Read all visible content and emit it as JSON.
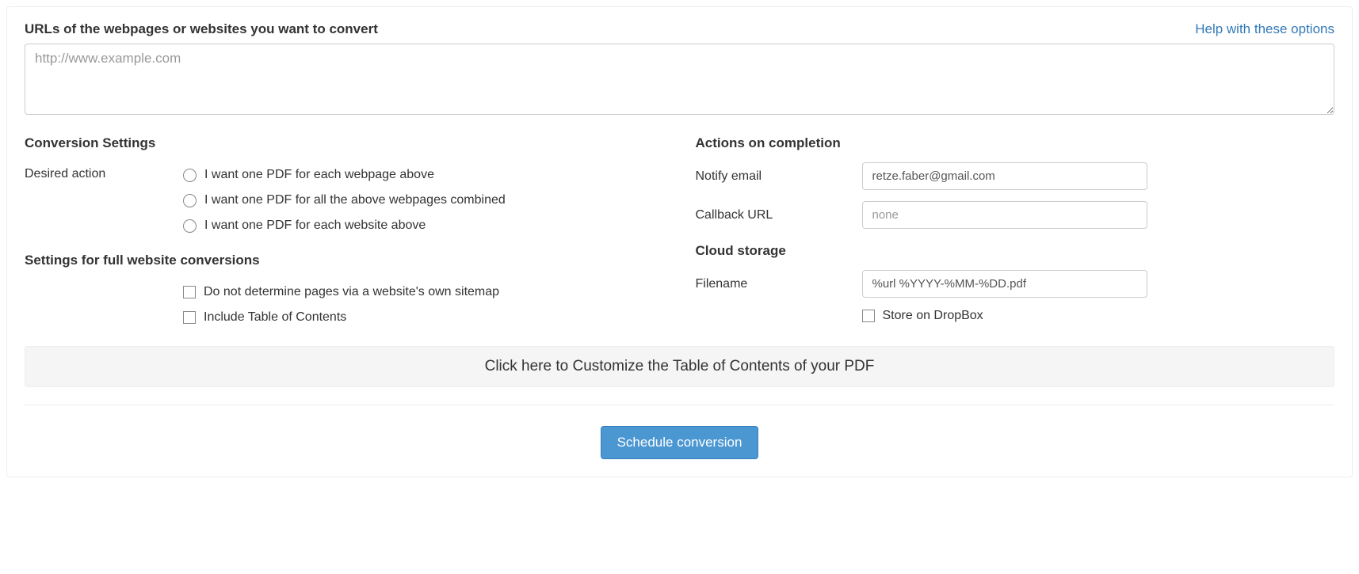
{
  "header": {
    "urls_label": "URLs of the webpages or websites you want to convert",
    "help_link": "Help with these options",
    "urls_placeholder": "http://www.example.com",
    "urls_value": ""
  },
  "left": {
    "conversion_heading": "Conversion Settings",
    "desired_action_label": "Desired action",
    "radios": [
      "I want one PDF for each webpage above",
      "I want one PDF for all the above webpages combined",
      "I want one PDF for each website above"
    ],
    "full_site_heading": "Settings for full website conversions",
    "checks": [
      "Do not determine pages via a website's own sitemap",
      "Include Table of Contents"
    ]
  },
  "right": {
    "actions_heading": "Actions on completion",
    "notify_label": "Notify email",
    "notify_value": "retze.faber@gmail.com",
    "callback_label": "Callback URL",
    "callback_placeholder": "none",
    "callback_value": "",
    "cloud_heading": "Cloud storage",
    "filename_label": "Filename",
    "filename_value": "%url %YYYY-%MM-%DD.pdf",
    "dropbox_label": "Store on DropBox"
  },
  "toc_bar": "Click here to Customize the Table of Contents of your PDF",
  "submit_label": "Schedule conversion"
}
